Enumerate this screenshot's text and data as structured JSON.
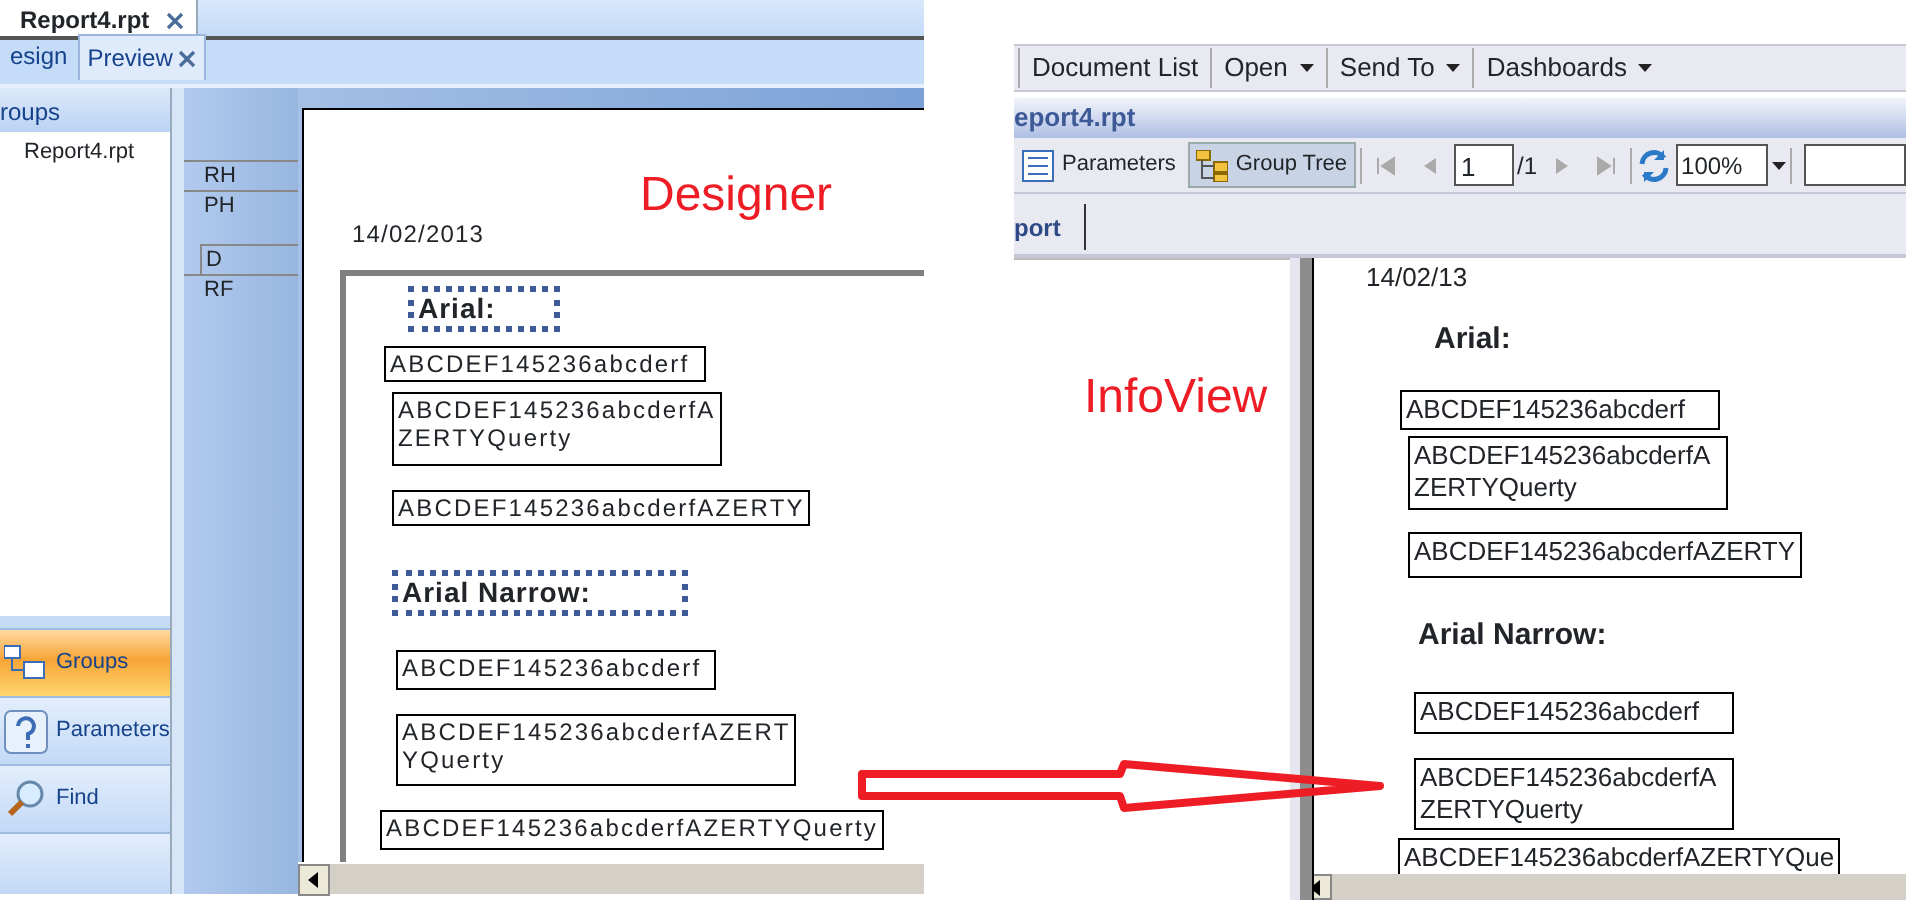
{
  "designer": {
    "doc_tabs": [
      {
        "label": "Report4.rpt",
        "closable": true
      }
    ],
    "view_tabs": [
      {
        "label": "esign",
        "selected": false,
        "closable": false
      },
      {
        "label": "Preview",
        "selected": true,
        "closable": true
      }
    ],
    "sidebar": {
      "header": "roups",
      "tree": [
        {
          "label": "Report4.rpt"
        }
      ],
      "panes": [
        {
          "kind": "groups",
          "label": "Groups",
          "selected": true
        },
        {
          "kind": "parameters",
          "label": "Parameters",
          "selected": false
        },
        {
          "kind": "find",
          "label": "Find",
          "selected": false
        }
      ]
    },
    "sections": [
      {
        "label": "RH"
      },
      {
        "label": "PH"
      },
      {
        "label": "D"
      },
      {
        "label": "RF"
      }
    ],
    "page": {
      "date": "14/02/2013",
      "objects": [
        {
          "kind": "heading",
          "lines": [
            "Arial:"
          ],
          "selected": true
        },
        {
          "kind": "field",
          "lines": [
            "ABCDEF145236abcderf"
          ],
          "selected": false
        },
        {
          "kind": "field",
          "lines": [
            "ABCDEF145236abcderfA",
            "ZERTYQuerty"
          ],
          "selected": false
        },
        {
          "kind": "field",
          "lines": [
            "ABCDEF145236abcderfAZERTY"
          ],
          "selected": false
        },
        {
          "kind": "heading",
          "lines": [
            "Arial Narrow:"
          ],
          "selected": true
        },
        {
          "kind": "field",
          "lines": [
            "ABCDEF145236abcderf"
          ],
          "selected": false
        },
        {
          "kind": "field",
          "lines": [
            "ABCDEF145236abcderfAZERT",
            "YQuerty"
          ],
          "selected": false
        },
        {
          "kind": "field",
          "lines": [
            "ABCDEF145236abcderfAZERTYQuerty"
          ],
          "selected": false
        }
      ]
    }
  },
  "infoview": {
    "menu": [
      {
        "label": "Document List",
        "dropdown": false
      },
      {
        "label": "Open",
        "dropdown": true
      },
      {
        "label": "Send To",
        "dropdown": true
      },
      {
        "label": "Dashboards",
        "dropdown": true
      }
    ],
    "title": "eport4.rpt",
    "toolbar": {
      "buttons": [
        {
          "kind": "parameters",
          "label": "Parameters",
          "selected": false
        },
        {
          "kind": "group-tree",
          "label": "Group Tree",
          "selected": true
        }
      ],
      "page_input": "1",
      "page_total": "/1",
      "zoom": "100%"
    },
    "tab": "port",
    "page": {
      "date": "14/02/13",
      "objects": [
        {
          "kind": "heading",
          "lines": [
            "Arial:"
          ]
        },
        {
          "kind": "field",
          "lines": [
            "ABCDEF145236abcderf"
          ]
        },
        {
          "kind": "field",
          "lines": [
            "ABCDEF145236abcderfA",
            "ZERTYQuerty"
          ]
        },
        {
          "kind": "field",
          "lines": [
            "ABCDEF145236abcderfAZERTY"
          ]
        },
        {
          "kind": "heading",
          "lines": [
            "Arial Narrow:"
          ]
        },
        {
          "kind": "field",
          "lines": [
            "ABCDEF145236abcderf"
          ]
        },
        {
          "kind": "field",
          "lines": [
            "ABCDEF145236abcderfA",
            "ZERTYQuerty"
          ]
        },
        {
          "kind": "field",
          "lines": [
            "ABCDEF145236abcderfAZERTYQue"
          ]
        }
      ]
    }
  },
  "annotations": [
    {
      "text": "Designer"
    },
    {
      "text": "InfoView"
    }
  ]
}
